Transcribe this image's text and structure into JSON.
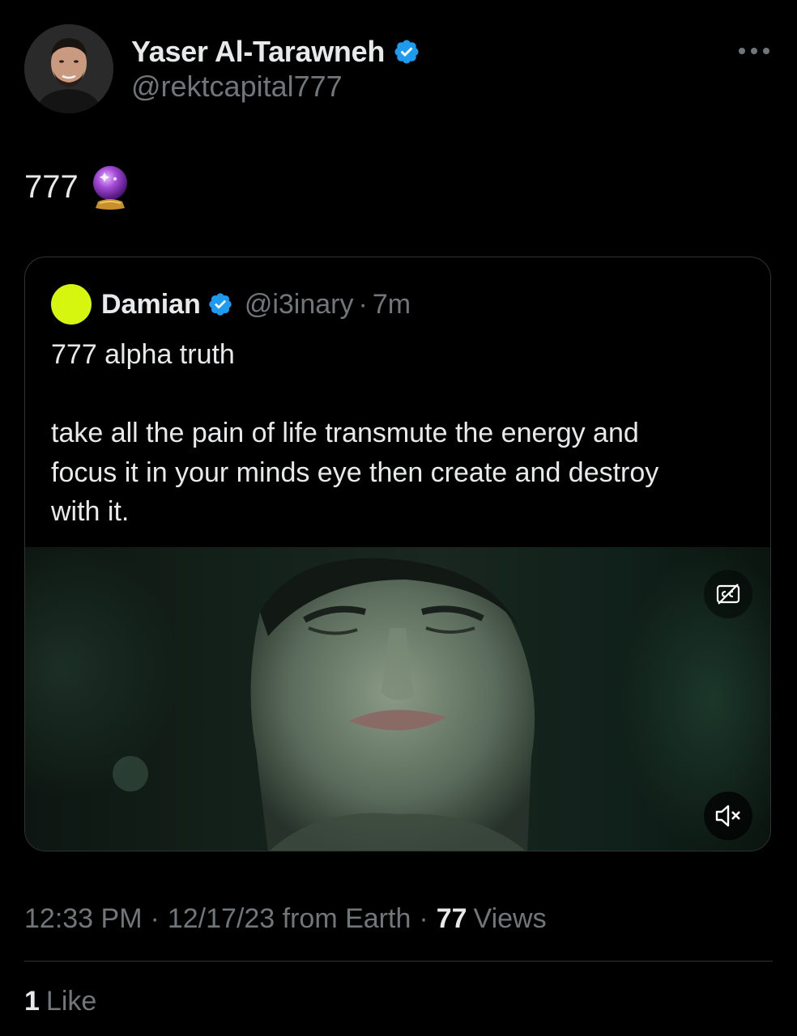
{
  "author": {
    "display_name": "Yaser Al-Tarawneh",
    "handle": "@rektcapital777",
    "verified": true,
    "avatar_icon": "profile-photo"
  },
  "tweet": {
    "text": "777",
    "emoji_icon": "crystal-ball-icon"
  },
  "quoted_tweet": {
    "display_name": "Damian",
    "handle": "@i3inary",
    "separator": "·",
    "time": "7m",
    "verified": true,
    "avatar_color": "#d6f50f",
    "text_lines": [
      "777 alpha truth",
      "",
      "take all the pain of life transmute the energy and",
      "focus it in your minds eye then create and destroy",
      "with it."
    ],
    "video": {
      "captions_icon": "closed-captions-icon",
      "mute_icon": "muted-speaker-icon"
    }
  },
  "meta": {
    "time": "12:33 PM",
    "separator": "·",
    "date_source": "12/17/23 from Earth",
    "views_count": "77",
    "views_label": "Views"
  },
  "likes": {
    "count": "1",
    "label": "Like"
  },
  "colors": {
    "background": "#000000",
    "text_primary": "#e7e9ea",
    "text_secondary": "#71767b",
    "verified_blue": "#1d9bf0",
    "border": "#2f3336"
  }
}
